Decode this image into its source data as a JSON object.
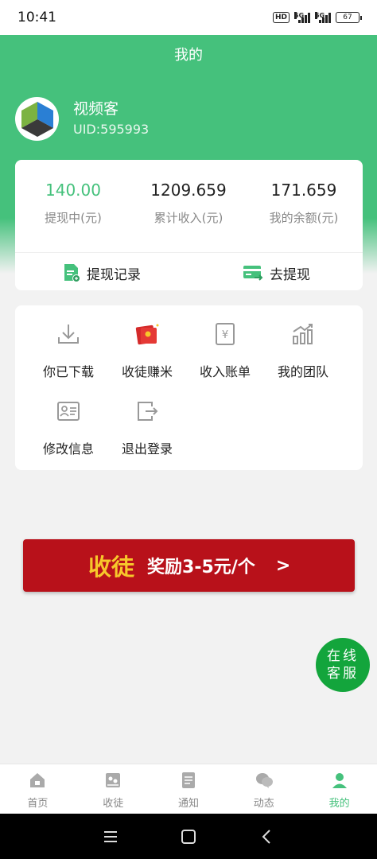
{
  "status_bar": {
    "time": "10:41",
    "hd": "HD",
    "net1": "5G",
    "net2": "5G",
    "battery": "67"
  },
  "header": {
    "title": "我的"
  },
  "user": {
    "name": "视频客",
    "uid": "UID:595993"
  },
  "stats": [
    {
      "value": "140.00",
      "label": "提现中(元)"
    },
    {
      "value": "1209.659",
      "label": "累计收入(元)"
    },
    {
      "value": "171.659",
      "label": "我的余额(元)"
    }
  ],
  "actions": {
    "withdraw_records": "提现记录",
    "withdraw": "去提现"
  },
  "menu": [
    {
      "label": "你已下载",
      "icon": "download-icon"
    },
    {
      "label": "收徒赚米",
      "icon": "red-envelope-icon"
    },
    {
      "label": "收入账单",
      "icon": "yen-bill-icon"
    },
    {
      "label": "我的团队",
      "icon": "bar-chart-icon"
    },
    {
      "label": "修改信息",
      "icon": "id-card-icon"
    },
    {
      "label": "退出登录",
      "icon": "logout-icon"
    }
  ],
  "invite_banner": {
    "main": "收徒",
    "sub": "奖励3-5元/个",
    "arrow": ">"
  },
  "support": {
    "line1": "在线",
    "line2": "客服"
  },
  "tabs": [
    {
      "label": "首页",
      "icon": "home-icon",
      "active": false
    },
    {
      "label": "收徒",
      "icon": "apprentice-icon",
      "active": false
    },
    {
      "label": "通知",
      "icon": "notice-icon",
      "active": false
    },
    {
      "label": "动态",
      "icon": "chat-icon",
      "active": false
    },
    {
      "label": "我的",
      "icon": "person-icon",
      "active": true
    }
  ],
  "colors": {
    "primary": "#45c17c",
    "banner_red": "#b8111a",
    "banner_gold": "#f7c72b",
    "support_green": "#13a53c"
  }
}
